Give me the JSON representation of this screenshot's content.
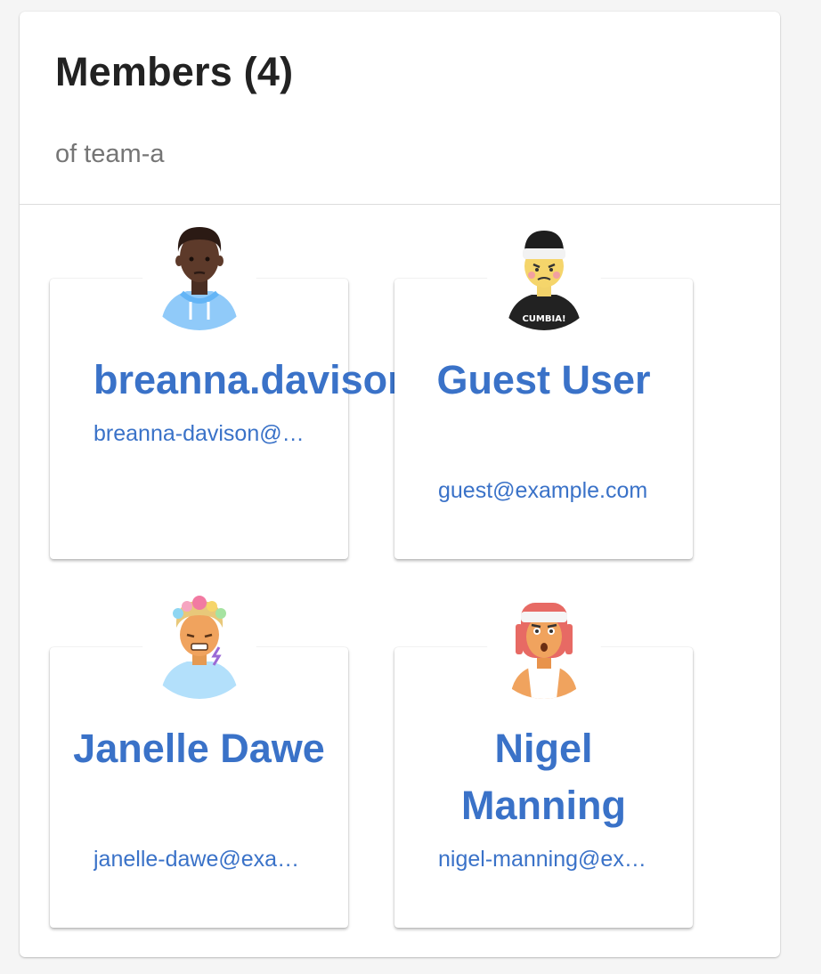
{
  "panel": {
    "title": "Members (4)",
    "subtitle": "of team-a"
  },
  "members": [
    {
      "name": "breanna.davison",
      "email": "breanna-davison@example.com",
      "avatar": "man-dark-skin-hoodie-avatar"
    },
    {
      "name": "Guest User",
      "email": "guest@example.com",
      "avatar": "beanie-cumbia-shirt-avatar"
    },
    {
      "name": "Janelle Dawe",
      "email": "janelle-dawe@example.com",
      "avatar": "flower-crown-avatar"
    },
    {
      "name": "Nigel Manning",
      "email": "nigel-manning@example.com",
      "avatar": "red-hair-headband-avatar"
    }
  ],
  "avatar_text": {
    "shirt": "CUMBIA!"
  },
  "colors": {
    "link": "#3a72c8",
    "title": "#222222",
    "subtitle": "#757575"
  }
}
